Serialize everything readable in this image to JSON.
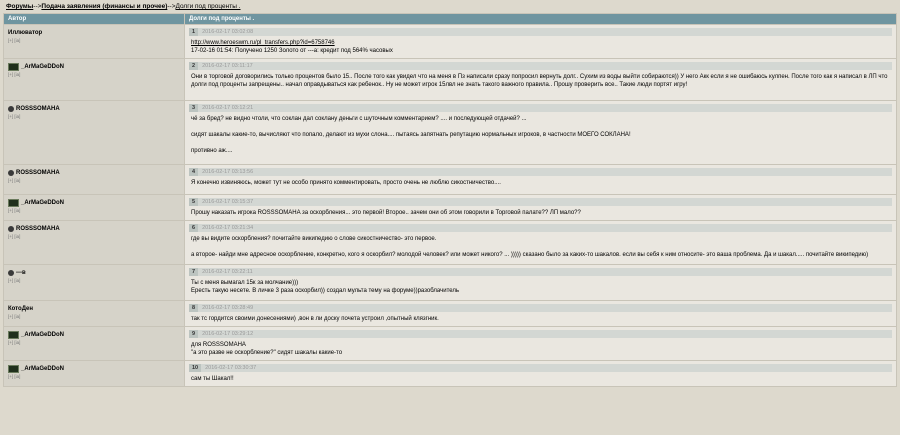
{
  "breadcrumb": {
    "forums": "Форумы",
    "sep1": "-->",
    "section": "Подача заявления (финансы и прочее)",
    "sep2": "-->",
    "topic": "Долги под проценты ."
  },
  "table": {
    "col_author": "Автор",
    "col_topic": "Долги под проценты ."
  },
  "posts": [
    {
      "author": "Иллюватор",
      "author_icon": "none",
      "links": "[+] [ia]",
      "num": "1",
      "date": "2016-02-17 03:02:08",
      "lines": [
        "http://www.heroeswm.ru/pl_transfers.php?id=6758746",
        "17-02-16 01:54: Получено 1250 Золото от ---а: кредит под 564% часовых"
      ]
    },
    {
      "author": "_ArMaGeDDoN",
      "author_icon": "avatar",
      "links": "[+] [ia]",
      "num": "2",
      "date": "2016-02-17 03:11:17",
      "lines": [
        "Они в торговой договорились только процентов было 15.. После того как увидел что на меня в Пз написали сразу попросил вернуть долг.. Сухим из воды выйти собираются)) У него Акк если я не ошибаюсь кулпен. После того как я написал в ЛП что долги под проценты запрещены.. начал оправдываться как ребенок.. Ну не может игрок 15лвл не знать такого важного правила.. Прошу проверить все.. Такие люди портят игру!"
      ]
    },
    {
      "author": "ROSSSOMAHA",
      "author_icon": "skull",
      "links": "[+] [ia]",
      "num": "3",
      "date": "2016-02-17 03:12:21",
      "lines": [
        "чё за бред? не видно чтоли, что соклан дал соклану деньги с шуточным комментарием? .... и последующей отдачей? ...",
        "сидят шакалы какие-то, вычисляют что попало, делают из мухи слона.... пытаясь запятнать репутацию нормальных игроков, в частности МОЕГО СОКЛАНА!",
        "противно аж...."
      ]
    },
    {
      "author": "ROSSSOMAHA",
      "author_icon": "skull",
      "links": "[+] [ia]",
      "num": "4",
      "date": "2016-02-17 03:13:56",
      "lines": [
        "Я конечно извиняюсь, может тут не особо принято комментировать, просто очень не люблю сикостничество...."
      ]
    },
    {
      "author": "_ArMaGeDDoN",
      "author_icon": "avatar",
      "links": "[+] [ia]",
      "num": "5",
      "date": "2016-02-17 03:15:37",
      "lines": [
        "Прошу наказать игрока ROSSSOMAHA за оскорбления... это первой! Второе.. зачем они об этом говорили в Торговой палате?? ЛП мало??"
      ]
    },
    {
      "author": "ROSSSOMAHA",
      "author_icon": "skull",
      "links": "[+] [ia]",
      "num": "6",
      "date": "2016-02-17 03:21:34",
      "lines": [
        "где вы видите оскорбления? почитайте википедию о слове сикостничество- это первое.",
        "а второе- найди мне адресное оскорбление, конкретно, кого я оскорбил? молодой человек? или может никого? ... ))))) сказано было за каких-то шакалов. если вы себя к ним относите- это ваша проблема. Да и шакал..... почитайте википедию)"
      ]
    },
    {
      "author": "---в",
      "author_icon": "skull",
      "links": "[+] [ia]",
      "num": "7",
      "date": "2016-02-17 03:22:11",
      "lines": [
        "Ты с меня вымагал 15к за молчание)))",
        "Ересть такую несете. В личке 3 раза оскорбил)) создал мульта тему на форуме))разоблачитель"
      ]
    },
    {
      "author": "КотоДен",
      "author_icon": "none",
      "links": "[+] [ia]",
      "num": "8",
      "date": "2016-02-17 03:28:49",
      "lines": [
        "так тс гордится своими донесениями) ,вон в ли доску почета устроил ,опытный клязгник."
      ]
    },
    {
      "author": "_ArMaGeDDoN",
      "author_icon": "avatar",
      "links": "[+] [ia]",
      "num": "9",
      "date": "2016-02-17 03:29:12",
      "lines": [
        "для ROSSSOMAHA",
        "\"а это разве не оскорбление?\" сидят шакалы какие-то"
      ]
    },
    {
      "author": "_ArMaGeDDoN",
      "author_icon": "avatar",
      "links": "[+] [ia]",
      "num": "10",
      "date": "2016-02-17 03:30:37",
      "lines": [
        "сам ты Шакал!!"
      ]
    }
  ]
}
